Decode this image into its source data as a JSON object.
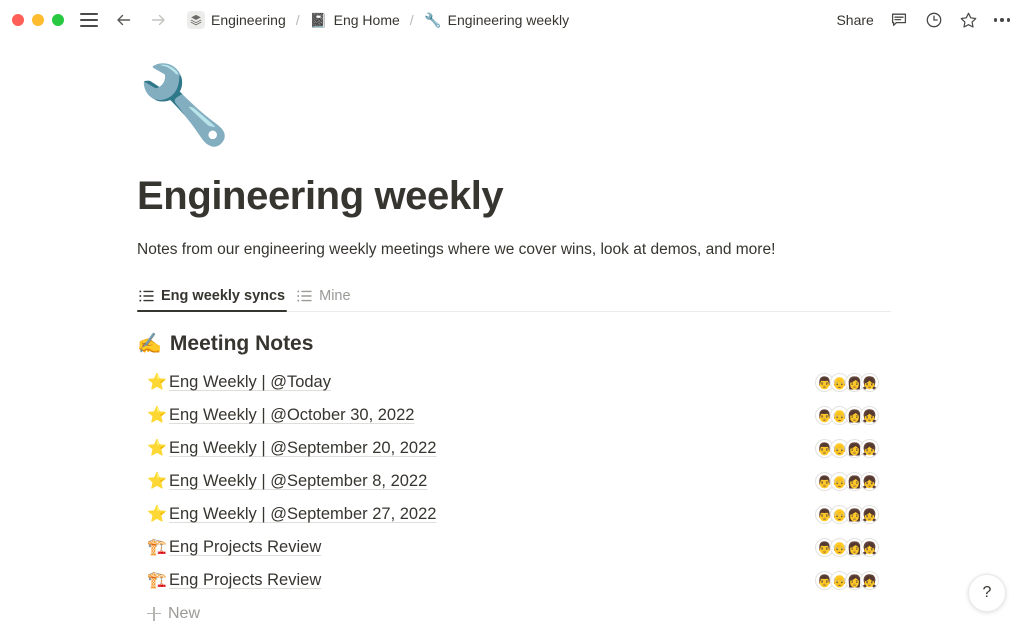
{
  "window": {
    "traffic_lights": [
      "close",
      "minimize",
      "zoom"
    ],
    "colors": {
      "close": "#ff5f57",
      "minimize": "#febc2e",
      "zoom": "#28c840",
      "text": "#37352f",
      "muted": "#9b9a97"
    }
  },
  "topbar": {
    "menu_icon": "hamburger-icon",
    "back_icon": "arrow-left-icon",
    "forward_icon": "arrow-right-icon",
    "breadcrumbs": [
      {
        "icon": "layers-stack-icon",
        "emoji": "",
        "label": "Engineering"
      },
      {
        "icon": "notebook-icon",
        "emoji": "📓",
        "label": "Eng Home"
      },
      {
        "icon": "wrench-icon",
        "emoji": "🔧",
        "label": "Engineering weekly"
      }
    ],
    "separator": "/",
    "share_label": "Share",
    "comment_icon": "comment-bubble-icon",
    "history_icon": "clock-icon",
    "favorite_icon": "star-outline-icon",
    "more_icon": "more-horizontal-icon"
  },
  "page": {
    "emoji": "🔧",
    "title": "Engineering weekly",
    "description": "Notes from our engineering weekly meetings where we cover wins, look at demos, and more!"
  },
  "tabs": [
    {
      "label": "Eng weekly syncs",
      "icon": "list-view-icon",
      "active": true
    },
    {
      "label": "Mine",
      "icon": "list-view-icon",
      "active": false
    }
  ],
  "section": {
    "emoji": "✍️",
    "title": "Meeting Notes"
  },
  "rows": [
    {
      "emoji": "⭐",
      "title": "Eng Weekly | @Today",
      "avatars": [
        "👨",
        "👴",
        "👩",
        "👧"
      ]
    },
    {
      "emoji": "⭐",
      "title": "Eng Weekly | @October 30, 2022",
      "avatars": [
        "👨",
        "👴",
        "👩",
        "👧"
      ]
    },
    {
      "emoji": "⭐",
      "title": "Eng Weekly | @September 20, 2022",
      "avatars": [
        "👨",
        "👴",
        "👩",
        "👧"
      ]
    },
    {
      "emoji": "⭐",
      "title": "Eng Weekly | @September 8, 2022",
      "avatars": [
        "👨",
        "👴",
        "👩",
        "👧"
      ]
    },
    {
      "emoji": "⭐",
      "title": "Eng Weekly | @September 27, 2022",
      "avatars": [
        "👨",
        "👴",
        "👩",
        "👧"
      ]
    },
    {
      "emoji": "🏗️",
      "title": "Eng Projects Review",
      "avatars": [
        "👨",
        "👴",
        "👩",
        "👧"
      ]
    },
    {
      "emoji": "🏗️",
      "title": "Eng Projects Review",
      "avatars": [
        "👨",
        "👴",
        "👩",
        "👧"
      ]
    }
  ],
  "new_row": {
    "label": "New",
    "icon": "plus-icon"
  },
  "help": {
    "label": "?"
  }
}
